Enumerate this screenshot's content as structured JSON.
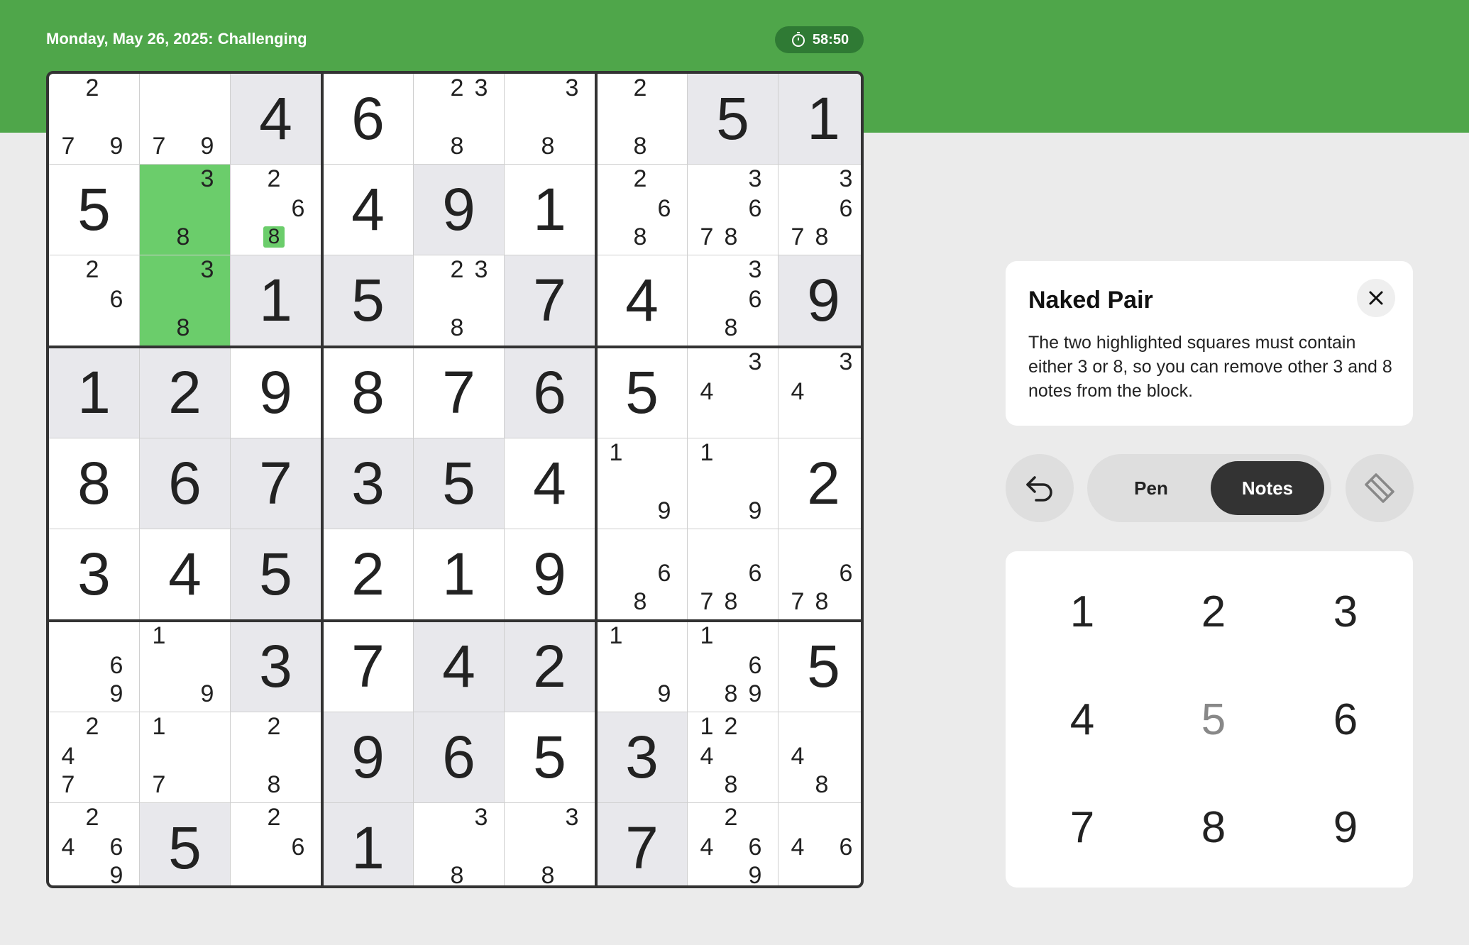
{
  "header": {
    "date_label": "Monday, May 26, 2025:",
    "difficulty": "Challenging",
    "timer": "58:50"
  },
  "board": {
    "cells": [
      [
        {
          "notes": [
            2,
            7,
            9
          ]
        },
        {
          "notes": [
            7,
            9
          ]
        },
        {
          "v": 4,
          "shaded": true
        },
        {
          "v": 6
        },
        {
          "notes": [
            2,
            3,
            8
          ]
        },
        {
          "notes": [
            3,
            8
          ]
        },
        {
          "notes": [
            2,
            8
          ]
        },
        {
          "v": 5,
          "shaded": true
        },
        {
          "v": 1,
          "shaded": true
        }
      ],
      [
        {
          "v": 5
        },
        {
          "notes": [
            3,
            8
          ],
          "highlight": true
        },
        {
          "notes": [
            2,
            6,
            8
          ],
          "note_highlight": [
            8
          ]
        },
        {
          "v": 4
        },
        {
          "v": 9,
          "shaded": true
        },
        {
          "v": 1
        },
        {
          "notes": [
            2,
            6,
            8
          ]
        },
        {
          "notes": [
            3,
            6,
            7,
            8
          ]
        },
        {
          "notes": [
            3,
            6,
            7,
            8
          ]
        }
      ],
      [
        {
          "notes": [
            2,
            6
          ]
        },
        {
          "notes": [
            3,
            8
          ],
          "highlight": true
        },
        {
          "v": 1,
          "shaded": true
        },
        {
          "v": 5,
          "shaded": true
        },
        {
          "notes": [
            2,
            3,
            8
          ]
        },
        {
          "v": 7,
          "shaded": true
        },
        {
          "v": 4
        },
        {
          "notes": [
            3,
            6,
            8
          ]
        },
        {
          "v": 9,
          "shaded": true
        }
      ],
      [
        {
          "v": 1,
          "shaded": true
        },
        {
          "v": 2,
          "shaded": true
        },
        {
          "v": 9
        },
        {
          "v": 8
        },
        {
          "v": 7
        },
        {
          "v": 6,
          "shaded": true
        },
        {
          "v": 5
        },
        {
          "notes": [
            3,
            4
          ]
        },
        {
          "notes": [
            3,
            4
          ]
        }
      ],
      [
        {
          "v": 8
        },
        {
          "v": 6,
          "shaded": true
        },
        {
          "v": 7,
          "shaded": true
        },
        {
          "v": 3,
          "shaded": true
        },
        {
          "v": 5,
          "shaded": true
        },
        {
          "v": 4
        },
        {
          "notes": [
            1,
            9
          ]
        },
        {
          "notes": [
            1,
            9
          ]
        },
        {
          "v": 2
        }
      ],
      [
        {
          "v": 3
        },
        {
          "v": 4
        },
        {
          "v": 5,
          "shaded": true
        },
        {
          "v": 2
        },
        {
          "v": 1
        },
        {
          "v": 9
        },
        {
          "notes": [
            6,
            8
          ]
        },
        {
          "notes": [
            6,
            7,
            8
          ]
        },
        {
          "notes": [
            6,
            7,
            8
          ]
        }
      ],
      [
        {
          "notes": [
            6,
            9
          ]
        },
        {
          "notes": [
            1,
            9
          ]
        },
        {
          "v": 3,
          "shaded": true
        },
        {
          "v": 7
        },
        {
          "v": 4,
          "shaded": true
        },
        {
          "v": 2,
          "shaded": true
        },
        {
          "notes": [
            1,
            9
          ]
        },
        {
          "notes": [
            1,
            6,
            8,
            9
          ]
        },
        {
          "v": 5
        }
      ],
      [
        {
          "notes": [
            2,
            4,
            7
          ]
        },
        {
          "notes": [
            1,
            7
          ]
        },
        {
          "notes": [
            2,
            8
          ]
        },
        {
          "v": 9,
          "shaded": true
        },
        {
          "v": 6,
          "shaded": true
        },
        {
          "v": 5
        },
        {
          "v": 3,
          "shaded": true
        },
        {
          "notes": [
            1,
            2,
            4,
            8
          ]
        },
        {
          "notes": [
            4,
            8
          ]
        }
      ],
      [
        {
          "notes": [
            2,
            4,
            6,
            9
          ]
        },
        {
          "v": 5,
          "shaded": true
        },
        {
          "notes": [
            2,
            6
          ]
        },
        {
          "v": 1,
          "shaded": true
        },
        {
          "notes": [
            3,
            8
          ]
        },
        {
          "notes": [
            3,
            8
          ]
        },
        {
          "v": 7,
          "shaded": true
        },
        {
          "notes": [
            2,
            4,
            6,
            9
          ]
        },
        {
          "notes": [
            4,
            6
          ]
        }
      ]
    ]
  },
  "hint": {
    "title": "Naked Pair",
    "body": "The two highlighted squares must contain either 3 or 8, so you can remove other 3 and 8 notes from the block.",
    "close_icon": "close-icon"
  },
  "controls": {
    "undo_icon": "undo-icon",
    "pen_label": "Pen",
    "notes_label": "Notes",
    "active_mode": "Notes",
    "erase_icon": "eraser-icon"
  },
  "numpad": {
    "keys": [
      "1",
      "2",
      "3",
      "4",
      "5",
      "6",
      "7",
      "8",
      "9"
    ],
    "dimmed": [
      "5"
    ]
  },
  "colors": {
    "header_green": "#4fa64a",
    "highlight_green": "#6bcd6b",
    "shaded_cell": "#e8e8ec"
  }
}
